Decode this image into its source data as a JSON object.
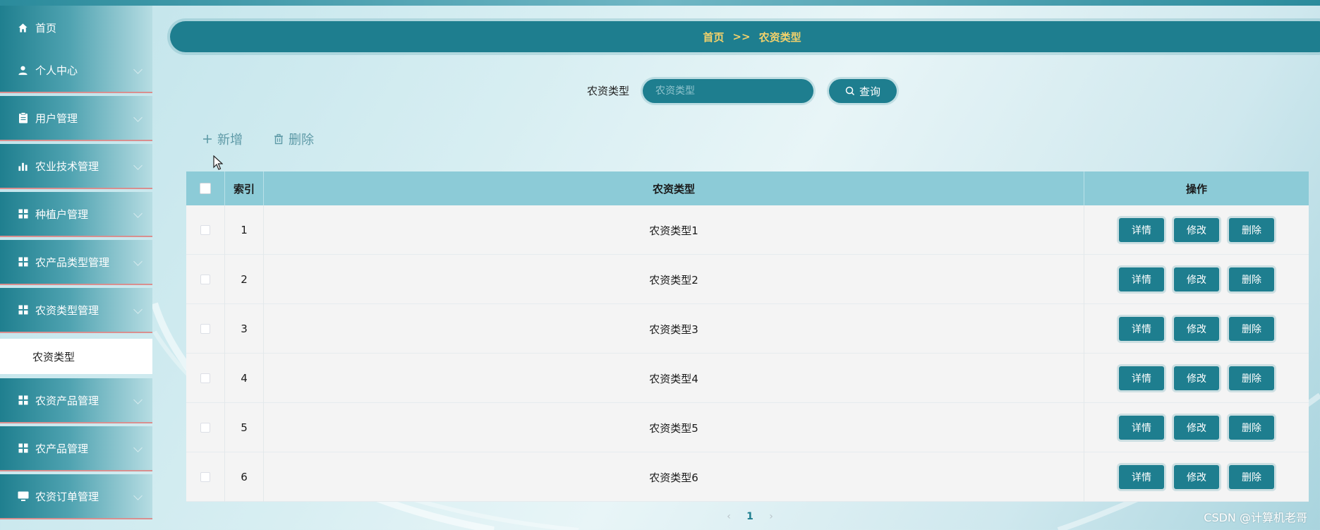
{
  "sidebar": {
    "items": [
      {
        "label": "首页",
        "icon": "home-icon",
        "expandable": false
      },
      {
        "label": "个人中心",
        "icon": "user-icon",
        "expandable": true
      },
      {
        "label": "用户管理",
        "icon": "clipboard-icon",
        "expandable": true
      },
      {
        "label": "农业技术管理",
        "icon": "bar-chart-icon",
        "expandable": true
      },
      {
        "label": "种植户管理",
        "icon": "grid-icon",
        "expandable": true
      },
      {
        "label": "农产品类型管理",
        "icon": "grid-icon",
        "expandable": true
      },
      {
        "label": "农资类型管理",
        "icon": "grid-icon",
        "expandable": true
      },
      {
        "label": "农资产品管理",
        "icon": "grid-icon",
        "expandable": true
      },
      {
        "label": "农产品管理",
        "icon": "grid-icon",
        "expandable": true
      },
      {
        "label": "农资订单管理",
        "icon": "monitor-icon",
        "expandable": true
      }
    ],
    "active_sub": "农资类型"
  },
  "breadcrumb": {
    "home": "首页",
    "separator": ">>",
    "current": "农资类型"
  },
  "search": {
    "label": "农资类型",
    "placeholder": "农资类型",
    "value": "",
    "button": "查询"
  },
  "toolbar": {
    "add": "新增",
    "delete": "删除"
  },
  "table": {
    "columns": {
      "index": "索引",
      "type": "农资类型",
      "actions": "操作"
    },
    "rows": [
      {
        "index": "1",
        "type": "农资类型1"
      },
      {
        "index": "2",
        "type": "农资类型2"
      },
      {
        "index": "3",
        "type": "农资类型3"
      },
      {
        "index": "4",
        "type": "农资类型4"
      },
      {
        "index": "5",
        "type": "农资类型5"
      },
      {
        "index": "6",
        "type": "农资类型6"
      }
    ],
    "actions": {
      "detail": "详情",
      "edit": "修改",
      "delete": "删除"
    }
  },
  "pagination": {
    "current": "1"
  },
  "watermark": "CSDN @计算机老哥",
  "colors": {
    "accent": "#1e7e8f",
    "header": "#8ccbd7",
    "crumb_text": "#f2d16b"
  }
}
